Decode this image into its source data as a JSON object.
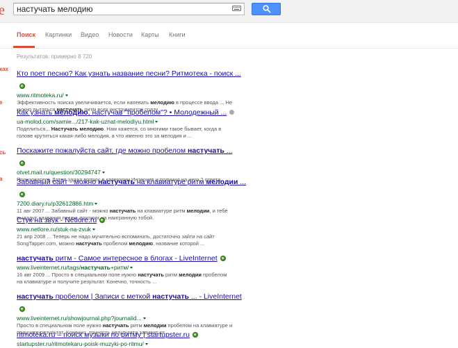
{
  "logo_fragment": "e",
  "search": {
    "query": "настучать мелодию",
    "keyboard_icon": "keyboard-icon",
    "button_icon": "magnifier-icon"
  },
  "tabs": [
    "Поиск",
    "Картинки",
    "Видео",
    "Новости",
    "Карты",
    "Книги"
  ],
  "stats": "Результатов: примерно 8 720",
  "left_fragments": [
    "ках",
    "е",
    "сь",
    "а"
  ],
  "results": [
    {
      "title": "Кто поет песню? Как узнать название песни? Ритмотека - поиск ...",
      "url": "www.ritmoteka.ru/",
      "snippet": [
        "Эффективность поиска увеличивается, если напевать <b>мелодию</b> в процессе ввода ... Не",
        "нужно пытаться <b>настучать</b> ритм всех инструментов сразу."
      ]
    },
    {
      "title": "Как узнать <b>мелодию</b>, настучав \"пробелом\"? • Молодежный ...",
      "url": "ua-molod.com/samie.../217-kak-uznat-melodiyu.html",
      "snippet": [
        "Поделиться... <b>Настучать мелодию</b>. Нам кажется, со многими такое бывает, когда в",
        "голове крутиться какая-либо мелодия, а что именно это за мелодия и ..."
      ]
    },
    {
      "title": "Поскажите пожалуйста сайт, где можно пробелом <b>настучать</b> ...",
      "url": "otvet.mail.ru/question/30294747",
      "snippet": [
        "Пользователь Дятел задал вопрос в категории Интернет и получил на него 2 ответа."
      ]
    },
    {
      "title": "Забавный сайт - можно <b>настучать</b> на клавиатуре ритм <b>мелодии</b> ...",
      "url": "7200.diary.ru/p32612886.htm",
      "snippet": [
        "11 авг 2007 ... Забавный сайт - можно <b>настучать</b> на клавиатуре ритм <b>мелодии</b>, и тебе",
        "выдадут названия песен, похожих на наигранную тобой."
      ]
    },
    {
      "title": "Стук на звук - Netlore.ru",
      "url": "www.netlore.ru/stuk-na-zvuk",
      "snippet": [
        "21 апр 2008 ... Теперь не надо мучительно вспоминать, достаточно зайти на сайт",
        "SongTapper.com, можно <b>настучать</b> пробелом <b>мелодию</b>, название которой ..."
      ]
    },
    {
      "title": "<b>настучать</b> ритм - Самое интересное в блогах - LiveInternet",
      "url": "www.liveinternet.ru/tags/<b>настучать</b>+ритм/",
      "snippet": [
        "16 авг 2009 ... Просто в специальном поле нужно <b>настучать</b> ритм <b>мелодии</b> пробелом",
        "на клавиатуре и получите результат. Конечно, точность ..."
      ]
    },
    {
      "title": "<b>настучать</b> пробелом | Записи с меткой <b>настучать</b> ... - LiveInternet",
      "url": "www.liveinternet.ru/showjournal.php?journalid...",
      "snippet": [
        "Просто в специальном поле нужно <b>настучать</b> ритм <b>мелодии</b> пробелом на клавиатуре и",
        "получите результат. Конечно, точность результата зависит от ..."
      ]
    },
    {
      "title": "ritmoteka.ru – поиск музыки по ритму | startupster.ru",
      "url": "startupster.ru/ritmotekaru-poisk-muzyki-po-ritmu/",
      "snippet": []
    }
  ]
}
